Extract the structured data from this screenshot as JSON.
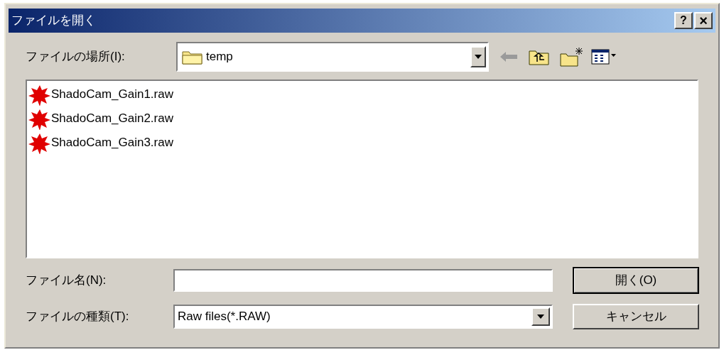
{
  "window": {
    "title": "ファイルを開く",
    "help_button": "?",
    "close_button": "×"
  },
  "location": {
    "label": "ファイルの場所(I):",
    "value": "temp"
  },
  "files": [
    {
      "name": "ShadoCam_Gain1.raw"
    },
    {
      "name": "ShadoCam_Gain2.raw"
    },
    {
      "name": "ShadoCam_Gain3.raw"
    }
  ],
  "file_name": {
    "label": "ファイル名(N):"
  },
  "file_type": {
    "label": "ファイルの種類(T):",
    "value": "Raw files(*.RAW)"
  },
  "buttons": [
    "開く(O)",
    "キャンセル"
  ]
}
